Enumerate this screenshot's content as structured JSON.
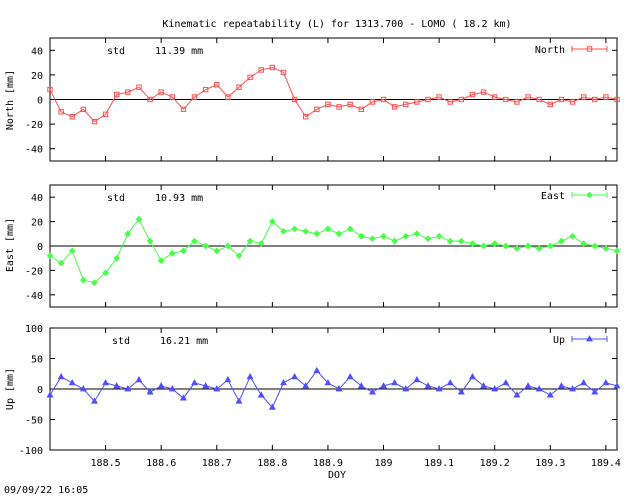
{
  "chart_data": [
    {
      "type": "line",
      "title": "Kinematic repeatability (L) for 1313.700 - LOMO  ( 18.2 km)",
      "ylabel": "North [mm]",
      "stat_label": "std",
      "stat_value": "11.39 mm",
      "ylim": [
        -50,
        50
      ],
      "yticks": [
        -40,
        -20,
        0,
        20,
        40
      ],
      "xlim": [
        188.4,
        189.42
      ],
      "zero_line": true,
      "series": [
        {
          "name": "North",
          "color": "#ff4f4f",
          "marker": "square",
          "x": [
            188.4,
            188.42,
            188.44,
            188.46,
            188.48,
            188.5,
            188.52,
            188.54,
            188.56,
            188.58,
            188.6,
            188.62,
            188.64,
            188.66,
            188.68,
            188.7,
            188.72,
            188.74,
            188.76,
            188.78,
            188.8,
            188.82,
            188.84,
            188.86,
            188.88,
            188.9,
            188.92,
            188.94,
            188.96,
            188.98,
            189.0,
            189.02,
            189.04,
            189.06,
            189.08,
            189.1,
            189.12,
            189.14,
            189.16,
            189.18,
            189.2,
            189.22,
            189.24,
            189.26,
            189.28,
            189.3,
            189.32,
            189.34,
            189.36,
            189.38,
            189.4,
            189.42
          ],
          "values": [
            8,
            -10,
            -14,
            -8,
            -18,
            -12,
            4,
            6,
            10,
            0,
            6,
            2,
            -8,
            2,
            8,
            12,
            2,
            10,
            18,
            24,
            26,
            22,
            0,
            -14,
            -8,
            -4,
            -6,
            -4,
            -8,
            -2,
            0,
            -6,
            -4,
            -2,
            0,
            2,
            -2,
            0,
            4,
            6,
            2,
            0,
            -2,
            2,
            0,
            -4,
            0,
            -2,
            2,
            0,
            2,
            0
          ]
        }
      ]
    },
    {
      "type": "line",
      "ylabel": "East [mm]",
      "stat_label": "std",
      "stat_value": "10.93 mm",
      "ylim": [
        -50,
        50
      ],
      "yticks": [
        -40,
        -20,
        0,
        20,
        40
      ],
      "xlim": [
        188.4,
        189.42
      ],
      "zero_line": true,
      "series": [
        {
          "name": "East",
          "color": "#47ff47",
          "marker": "diamond",
          "x": [
            188.4,
            188.42,
            188.44,
            188.46,
            188.48,
            188.5,
            188.52,
            188.54,
            188.56,
            188.58,
            188.6,
            188.62,
            188.64,
            188.66,
            188.68,
            188.7,
            188.72,
            188.74,
            188.76,
            188.78,
            188.8,
            188.82,
            188.84,
            188.86,
            188.88,
            188.9,
            188.92,
            188.94,
            188.96,
            188.98,
            189.0,
            189.02,
            189.04,
            189.06,
            189.08,
            189.1,
            189.12,
            189.14,
            189.16,
            189.18,
            189.2,
            189.22,
            189.24,
            189.26,
            189.28,
            189.3,
            189.32,
            189.34,
            189.36,
            189.38,
            189.4,
            189.42
          ],
          "values": [
            -8,
            -14,
            -4,
            -28,
            -30,
            -22,
            -10,
            10,
            22,
            4,
            -12,
            -6,
            -4,
            4,
            0,
            -4,
            0,
            -8,
            4,
            2,
            20,
            12,
            14,
            12,
            10,
            14,
            10,
            14,
            8,
            6,
            8,
            4,
            8,
            10,
            6,
            8,
            4,
            4,
            2,
            0,
            2,
            0,
            -2,
            0,
            -2,
            0,
            4,
            8,
            2,
            0,
            -2,
            -4
          ]
        }
      ]
    },
    {
      "type": "line",
      "xlabel": "DOY",
      "ylabel": "Up [mm]",
      "stat_label": "std",
      "stat_value": "16.21 mm",
      "ylim": [
        -100,
        100
      ],
      "yticks": [
        -100,
        -50,
        0,
        50,
        100
      ],
      "xlim": [
        188.4,
        189.42
      ],
      "xticks": [
        188.5,
        188.6,
        188.7,
        188.8,
        188.9,
        189.0,
        189.1,
        189.2,
        189.3,
        189.4
      ],
      "xtick_labels": [
        "188.5",
        "188.6",
        "188.7",
        "188.8",
        "188.9",
        "189",
        "189.1",
        "189.2",
        "189.3",
        "189.4"
      ],
      "zero_line": true,
      "series": [
        {
          "name": "Up",
          "color": "#4f4fff",
          "marker": "triangle",
          "x": [
            188.4,
            188.42,
            188.44,
            188.46,
            188.48,
            188.5,
            188.52,
            188.54,
            188.56,
            188.58,
            188.6,
            188.62,
            188.64,
            188.66,
            188.68,
            188.7,
            188.72,
            188.74,
            188.76,
            188.78,
            188.8,
            188.82,
            188.84,
            188.86,
            188.88,
            188.9,
            188.92,
            188.94,
            188.96,
            188.98,
            189.0,
            189.02,
            189.04,
            189.06,
            189.08,
            189.1,
            189.12,
            189.14,
            189.16,
            189.18,
            189.2,
            189.22,
            189.24,
            189.26,
            189.28,
            189.3,
            189.32,
            189.34,
            189.36,
            189.38,
            189.4,
            189.42
          ],
          "values": [
            -10,
            20,
            10,
            0,
            -20,
            10,
            5,
            0,
            15,
            -5,
            5,
            0,
            -15,
            10,
            5,
            0,
            15,
            -20,
            20,
            -10,
            -30,
            10,
            20,
            5,
            30,
            10,
            0,
            20,
            5,
            -5,
            5,
            10,
            0,
            15,
            5,
            0,
            10,
            -5,
            20,
            5,
            0,
            10,
            -10,
            5,
            0,
            -10,
            5,
            0,
            10,
            -5,
            10,
            5
          ]
        }
      ]
    }
  ],
  "footer_timestamp": "09/09/22 16:05"
}
